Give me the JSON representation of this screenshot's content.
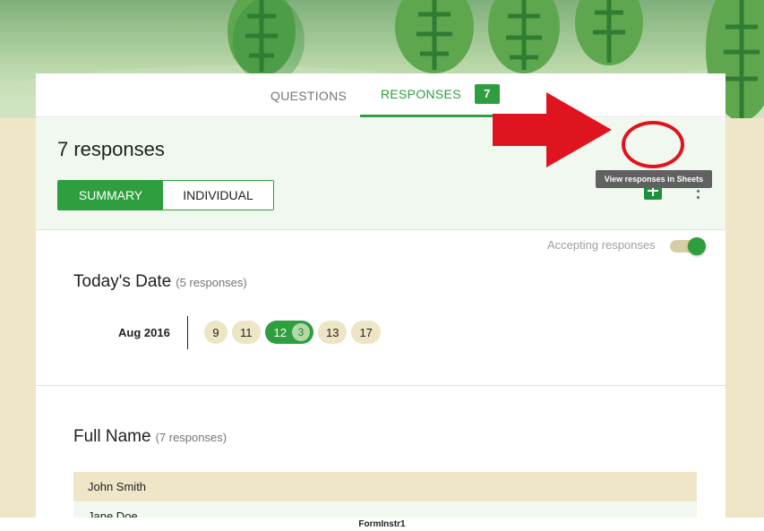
{
  "tabs": [
    {
      "label": "QUESTIONS"
    },
    {
      "label": "RESPONSES",
      "badge": "7"
    }
  ],
  "summary": {
    "title": "7 responses",
    "view_toggle": [
      "SUMMARY",
      "INDIVIDUAL"
    ],
    "active_view": "SUMMARY",
    "sheets_tooltip": "View responses in Sheets",
    "accepting_label": "Accepting responses",
    "accepting_on": true
  },
  "questions": [
    {
      "title": "Today's Date",
      "count": "(5 responses)",
      "month_label": "Aug 2016",
      "days": [
        {
          "day": "9"
        },
        {
          "day": "11"
        },
        {
          "day": "12",
          "count": "3",
          "active": true
        },
        {
          "day": "13"
        },
        {
          "day": "17"
        }
      ]
    },
    {
      "title": "Full Name",
      "count": "(7 responses)",
      "answers": [
        "John Smith",
        "Jane Doe"
      ]
    }
  ],
  "footer": {
    "label": "FormInstr1"
  },
  "colors": {
    "accent": "#2e9e3e",
    "background": "#efe6c8",
    "annotation": "#e0141e"
  },
  "icons": {
    "sheets": "sheets-icon",
    "more": "more-vert-icon"
  }
}
